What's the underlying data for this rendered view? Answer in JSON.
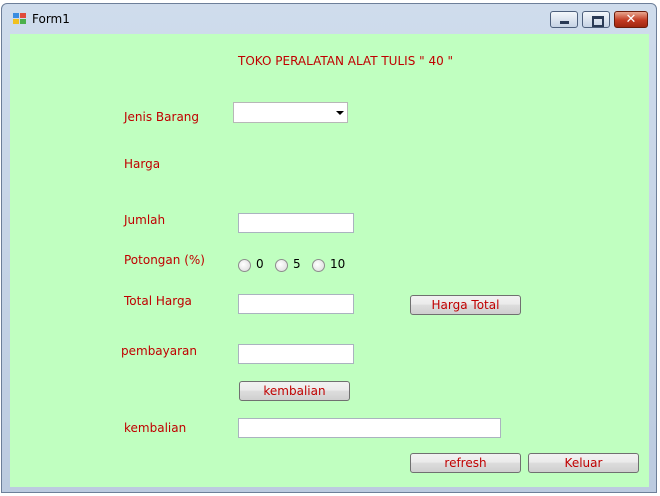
{
  "window": {
    "title": "Form1"
  },
  "form": {
    "heading": "TOKO PERALATAN ALAT TULIS \" 40 \"",
    "labels": {
      "jenis_barang": "Jenis Barang",
      "harga": "Harga",
      "jumlah": "Jumlah",
      "potongan": "Potongan (%)",
      "total_harga": "Total Harga",
      "pembayaran": "pembayaran",
      "kembalian": "kembalian"
    },
    "jenis_barang_value": "",
    "jumlah_value": "",
    "total_harga_value": "",
    "pembayaran_value": "",
    "kembalian_value": "",
    "potongan_options": [
      "0",
      "5",
      "10"
    ],
    "buttons": {
      "harga_total": "Harga Total",
      "kembalian": "kembalian",
      "refresh": "refresh",
      "keluar": "Keluar"
    }
  },
  "colors": {
    "background": "#c0ffc0",
    "label": "#c00000"
  }
}
